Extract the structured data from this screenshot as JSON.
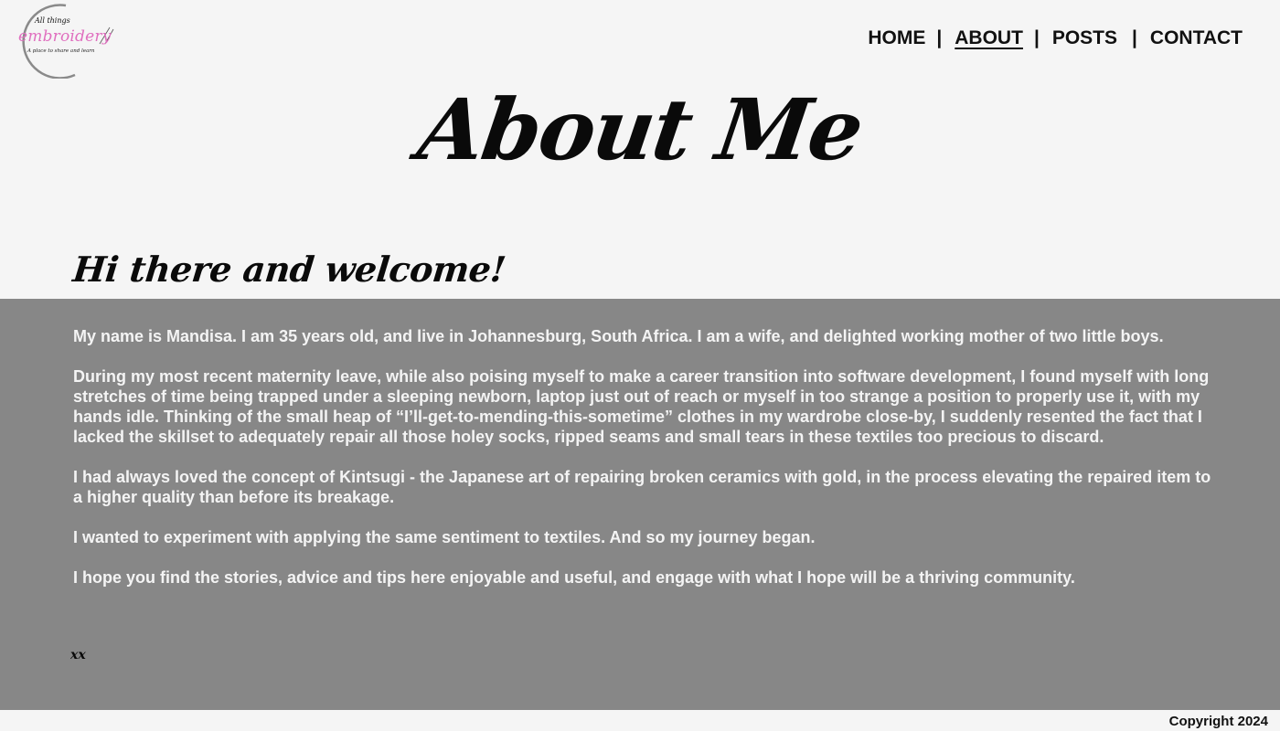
{
  "logo": {
    "line1": "All things",
    "line2": "embroidery",
    "tagline": "A place to share and learn"
  },
  "nav": {
    "items": [
      {
        "label": "HOME"
      },
      {
        "label": "ABOUT"
      },
      {
        "label": "POSTS"
      },
      {
        "label": "CONTACT"
      }
    ],
    "separator": "|",
    "active": "ABOUT"
  },
  "page": {
    "title": "About Me",
    "greeting": "Hi there and welcome!"
  },
  "content": {
    "paragraphs": [
      "My name is Mandisa. I am 35 years old, and live in Johannesburg, South Africa. I am a wife, and delighted working mother of two little boys.",
      "During my most recent maternity leave, while also poising myself to make a career transition into software development, I  found myself with long stretches of time being trapped under a sleeping newborn, laptop just out of reach or myself in too strange a position to properly use it, with my hands idle. Thinking of the small heap of “I’ll-get-to-mending-this-sometime” clothes in my wardrobe close-by, I suddenly resented the fact that I lacked the skillset to adequately repair all those holey socks, ripped seams and small tears in these textiles too precious to discard.",
      "I had always loved the concept of Kintsugi - the Japanese art of repairing broken ceramics with gold, in the process elevating the repaired item to a higher quality than before its breakage.",
      "I wanted to experiment with applying the same sentiment to textiles. And so my journey began.",
      "I hope you find the stories, advice and tips here enjoyable and useful, and engage with what I hope will be a thriving community."
    ],
    "signoff": "xx"
  },
  "footer": {
    "copyright": "Copyright 2024"
  },
  "colors": {
    "background": "#f5f5f5",
    "panel": "#878787",
    "panel_text": "#f4f4f4",
    "logo_pink": "#e06fbf"
  }
}
